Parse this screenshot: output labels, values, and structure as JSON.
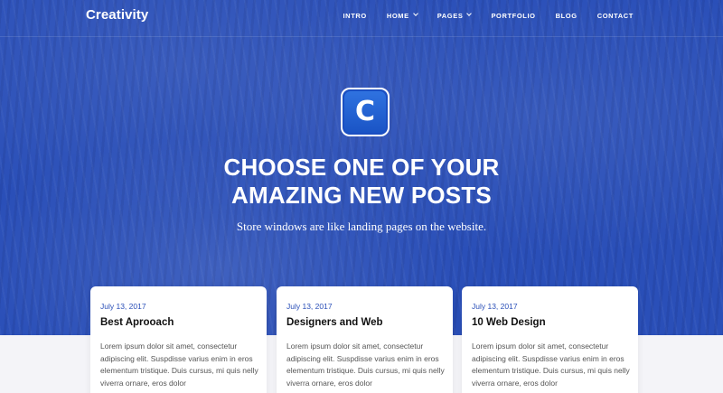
{
  "brand": {
    "name": "Creativity"
  },
  "nav": {
    "items": [
      {
        "label": "INTRO",
        "dropdown": false
      },
      {
        "label": "HOME",
        "dropdown": true
      },
      {
        "label": "PAGES",
        "dropdown": true
      },
      {
        "label": "PORTFOLIO",
        "dropdown": false
      },
      {
        "label": "BLOG",
        "dropdown": false
      },
      {
        "label": "CONTACT",
        "dropdown": false
      }
    ]
  },
  "hero": {
    "icon_letter": "C",
    "title_line1": "CHOOSE ONE OF YOUR",
    "title_line2": "AMAZING NEW POSTS",
    "subtitle": "Store windows are like landing pages on the website.",
    "background_color": "#2a4fb8"
  },
  "posts": [
    {
      "date": "July 13, 2017",
      "title": "Best Aprooach",
      "excerpt": "Lorem ipsum dolor sit amet, consectetur adipiscing elit. Suspdisse varius enim in eros elementum tristique. Duis cursus, mi quis nelly viverra ornare, eros dolor"
    },
    {
      "date": "July 13, 2017",
      "title": "Designers and Web",
      "excerpt": "Lorem ipsum dolor sit amet, consectetur adipiscing elit. Suspdisse varius enim in eros elementum tristique. Duis cursus, mi quis nelly viverra ornare, eros dolor"
    },
    {
      "date": "July 13, 2017",
      "title": "10 Web Design",
      "excerpt": "Lorem ipsum dolor sit amet, consectetur adipiscing elit. Suspdisse varius enim in eros elementum tristique. Duis cursus, mi quis nelly viverra ornare, eros dolor"
    }
  ],
  "colors": {
    "accent": "#2a4fb8",
    "page_bg": "#f4f4f8"
  }
}
